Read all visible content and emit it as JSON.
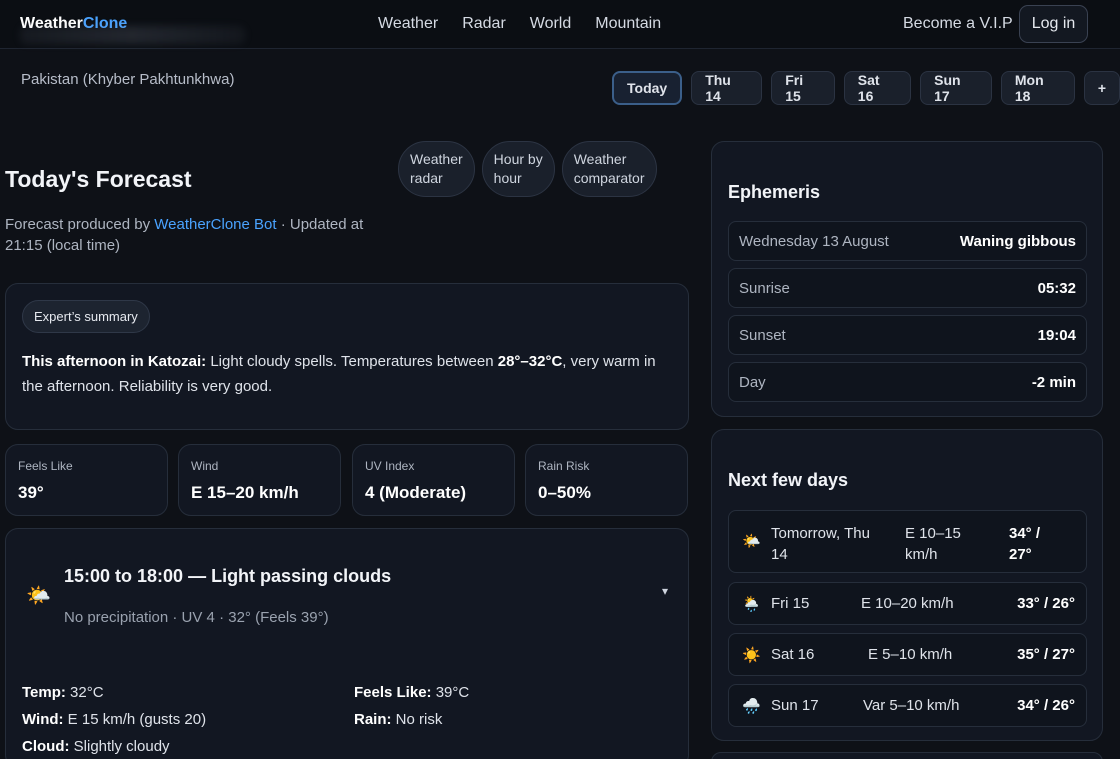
{
  "brand": {
    "name_main": "Weather",
    "name_accent": "Clone"
  },
  "nav": {
    "links": [
      "Weather",
      "Radar",
      "World",
      "Mountain"
    ],
    "vip": "Become a V.I.P",
    "login": "Log in"
  },
  "location": "Pakistan (Khyber Pakhtunkhwa)",
  "day_tabs": [
    "Today",
    "Thu 14",
    "Fri 15",
    "Sat 16",
    "Sun 17",
    "Mon 18",
    "+"
  ],
  "title": "Today's Forecast",
  "view_pills": [
    {
      "line1": "Weather",
      "line2": "radar"
    },
    {
      "line1": "Hour by",
      "line2": "hour"
    },
    {
      "line1": "Weather",
      "line2": "comparator"
    }
  ],
  "produced": {
    "prefix": "Forecast produced by ",
    "bot": "WeatherClone Bot",
    "suffix": " · Updated at 21:15 (local time)"
  },
  "summary": {
    "badge": "Expert’s summary",
    "lead": "This afternoon in Katozai:",
    "text1": " Light cloudy spells. Temperatures between ",
    "temps": "28°–32°C",
    "text2": ", very warm in the afternoon. Reliability is very good."
  },
  "stats": [
    {
      "label": "Feels Like",
      "value": "39°"
    },
    {
      "label": "Wind",
      "value": "E 15–20 km/h"
    },
    {
      "label": "UV Index",
      "value": "4 (Moderate)"
    },
    {
      "label": "Rain Risk",
      "value": "0–50%"
    }
  ],
  "period": {
    "icon": "🌤️",
    "title": "15:00 to 18:00 — Light passing clouds",
    "subtitle": "No precipitation · UV 4 · 32° (Feels 39°)",
    "chevron": "▾",
    "details": [
      {
        "k": "Temp:",
        "v": " 32°C"
      },
      {
        "k": "Feels Like:",
        "v": " 39°C"
      },
      {
        "k": "Wind:",
        "v": " E 15 km/h (gusts 20)"
      },
      {
        "k": "Rain:",
        "v": " No risk"
      },
      {
        "k": "Cloud:",
        "v": " Slightly cloudy"
      }
    ]
  },
  "ephemeris": {
    "title": "Ephemeris",
    "rows": [
      {
        "k": "Wednesday 13 August",
        "v": "Waning gibbous"
      },
      {
        "k": "Sunrise",
        "v": "05:32"
      },
      {
        "k": "Sunset",
        "v": "19:04"
      },
      {
        "k": "Day",
        "v": "-2 min"
      }
    ]
  },
  "next_days": {
    "title": "Next few days",
    "rows": [
      {
        "icon": "🌤️",
        "day_line1": "Tomorrow, Thu",
        "day_line2": "14",
        "wind_line1": "E 10–15",
        "wind_line2": "km/h",
        "temp_line1": "34° /",
        "temp_line2": "27°"
      },
      {
        "icon": "🌦️",
        "day": "Fri 15",
        "wind": "E 10–20 km/h",
        "temp": "33° / 26°"
      },
      {
        "icon": "☀️",
        "day": "Sat 16",
        "wind": "E 5–10 km/h",
        "temp": "35° / 27°"
      },
      {
        "icon": "🌧️",
        "day": "Sun 17",
        "wind": "Var 5–10 km/h",
        "temp": "34° / 26°"
      }
    ]
  }
}
